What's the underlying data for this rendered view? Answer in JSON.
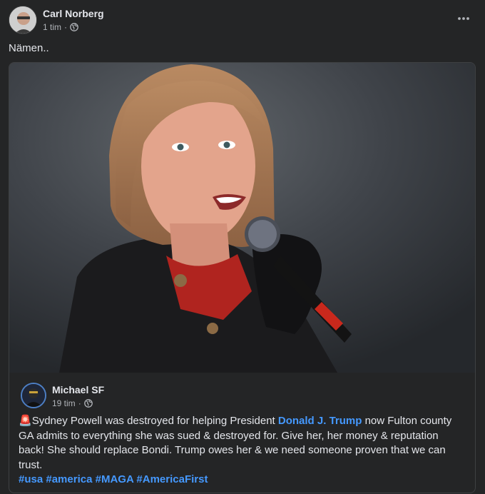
{
  "post": {
    "author": "Carl Norberg",
    "time": "1 tim",
    "separator": "·",
    "text": "Nämen..",
    "more_label": "•••"
  },
  "shared": {
    "author": "Michael SF",
    "time": "19 tim",
    "separator": "·",
    "emoji": "🚨",
    "text_before": "Sydney Powell was destroyed for helping President ",
    "mention": "Donald J. Trump",
    "text_after": " now Fulton county GA admits to everything she was sued & destroyed for. Give her, her money & reputation back! She should replace Bondi. Trump owes her & we need someone proven that we can trust.",
    "hashtags": [
      "#usa",
      "#america",
      "#MAGA",
      "#AmericaFirst"
    ]
  },
  "colors": {
    "background": "#242526",
    "text": "#e4e6eb",
    "secondary_text": "#b0b3b8",
    "link": "#4599ff"
  }
}
